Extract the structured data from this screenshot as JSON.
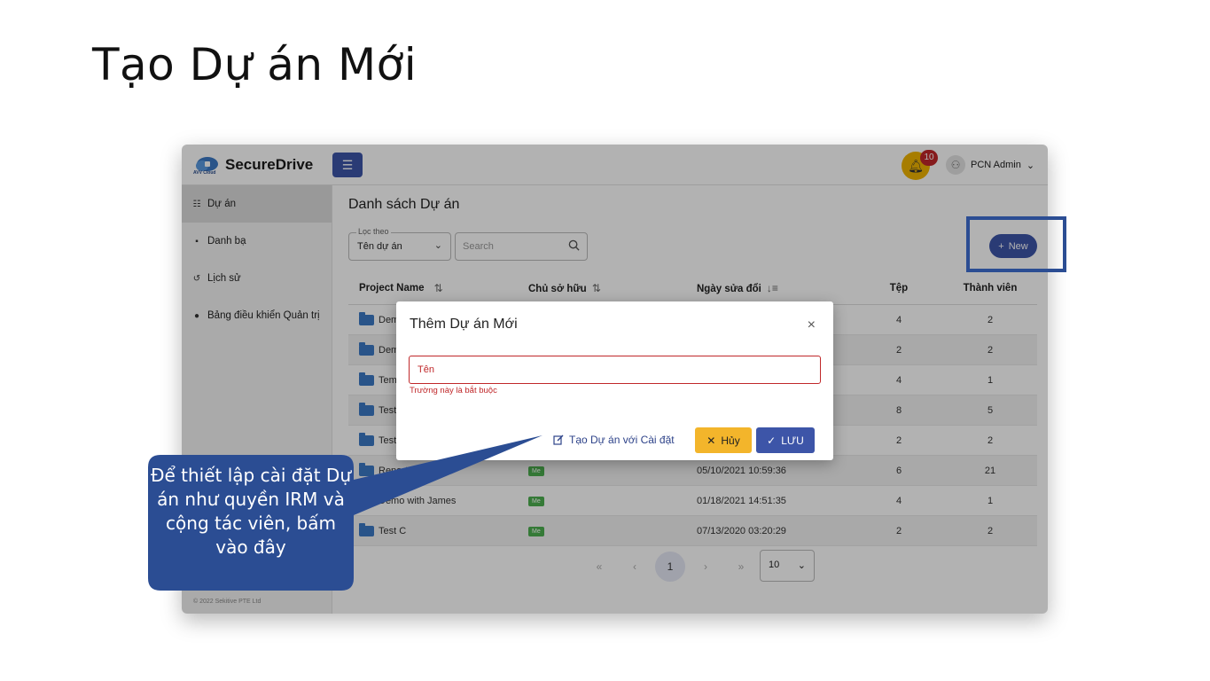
{
  "slide": {
    "title": "Tạo Dự án Mới"
  },
  "app": {
    "brand": "SecureDrive",
    "logo_sub": "AVV Cloud",
    "menu_icon": "☰",
    "notifications": {
      "count": "10"
    },
    "user": {
      "name": "PCN Admin",
      "chevron": "⌄"
    },
    "sidebar": [
      {
        "icon": "☷",
        "label": "Dự án",
        "active": true
      },
      {
        "icon": "▪",
        "label": "Danh bạ"
      },
      {
        "icon": "↺",
        "label": "Lịch sử"
      },
      {
        "icon": "👤",
        "label": "Bảng điều khiển Quản trị"
      }
    ],
    "copyright": "© 2022 Sekitive PTE Ltd",
    "page_heading": "Danh sách Dự án",
    "filter": {
      "legend": "Lọc theo",
      "value": "Tên dự án"
    },
    "search": {
      "placeholder": "Search"
    },
    "new_button": "New",
    "table": {
      "headers": [
        "Project Name",
        "Chủ sở hữu",
        "Ngày sửa đổi",
        "Tệp",
        "Thành viên"
      ],
      "rows": [
        {
          "name": "Dem",
          "owner": "",
          "date": "",
          "files": "4",
          "members": "2"
        },
        {
          "name": "Dem",
          "owner": "",
          "date": "",
          "files": "2",
          "members": "2"
        },
        {
          "name": "Tema",
          "owner": "",
          "date": "",
          "files": "4",
          "members": "1"
        },
        {
          "name": "Test",
          "owner": "",
          "date": "",
          "files": "8",
          "members": "5"
        },
        {
          "name": "Test",
          "owner": "",
          "date": "",
          "files": "2",
          "members": "2"
        },
        {
          "name": "Report",
          "owner": "Me",
          "date": "05/10/2021 10:59:36",
          "files": "6",
          "members": "21"
        },
        {
          "name": "Demo with James",
          "owner": "Me",
          "date": "01/18/2021 14:51:35",
          "files": "4",
          "members": "1"
        },
        {
          "name": "Test C",
          "owner": "Me",
          "date": "07/13/2020 03:20:29",
          "files": "2",
          "members": "2"
        }
      ]
    },
    "pagination": {
      "first": "«",
      "prev": "‹",
      "current": "1",
      "next": "›",
      "last": "»",
      "per_page": "10"
    }
  },
  "modal": {
    "title": "Thêm Dự án Mới",
    "close": "×",
    "name_placeholder": "Tên",
    "error": "Trường này là bắt buộc",
    "settings_link": "Tạo Dự án với Cài đặt",
    "cancel": "Hủy",
    "save": "LƯU"
  },
  "callout": {
    "text": "Để thiết lập cài đặt Dự án như quyền IRM và cộng tác viên, bấm vào đây"
  },
  "colors": {
    "accent": "#3d55a8",
    "error": "#c0282a",
    "warning": "#f3b52b",
    "callout": "#2b4d93"
  }
}
